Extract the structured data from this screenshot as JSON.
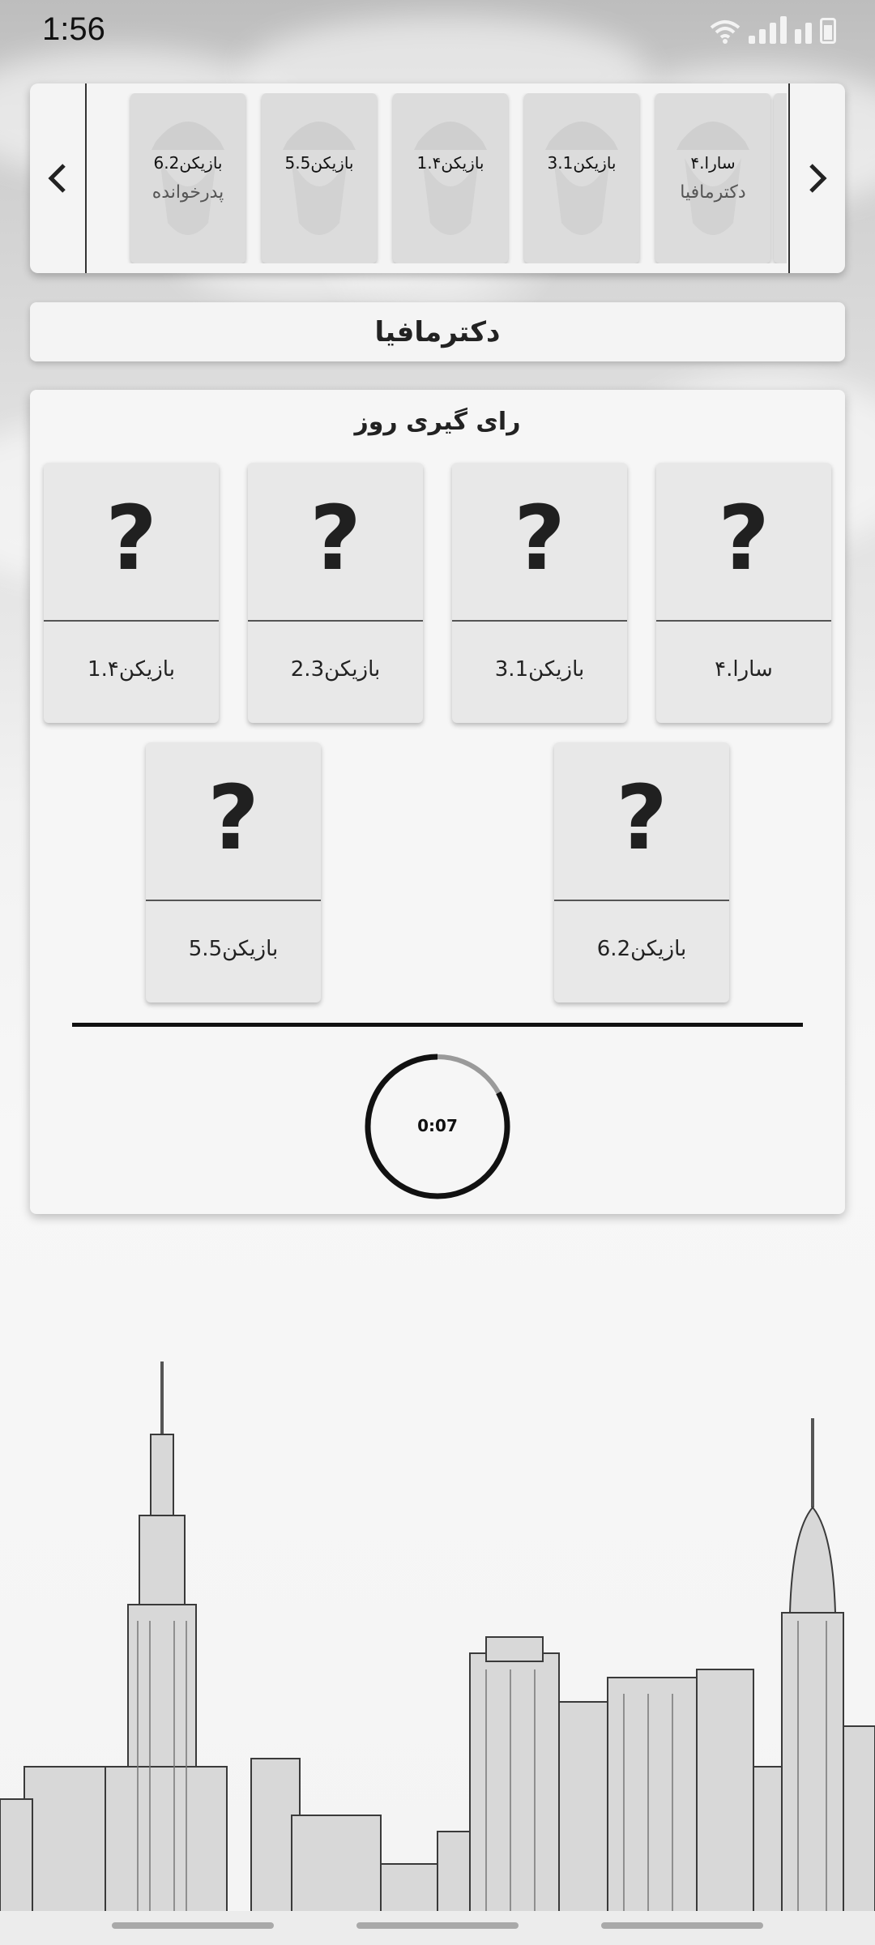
{
  "status_bar": {
    "time": "1:56"
  },
  "carousel": {
    "prev_icon": "chevron-left-icon",
    "next_icon": "chevron-right-icon",
    "players": [
      {
        "name": "۴.سارا",
        "role": "دکترمافیا"
      },
      {
        "name": "3.بازیکن1",
        "role": ""
      },
      {
        "name": "1.بازیکن۴",
        "role": ""
      },
      {
        "name": "5.بازیکن5",
        "role": ""
      },
      {
        "name": "6.بازیکن2",
        "role": "پدرخوانده"
      }
    ]
  },
  "title": "دکترمافیا",
  "voting": {
    "title": "رای گیری روز",
    "question_mark": "?",
    "cards": [
      {
        "name": "۴.سارا"
      },
      {
        "name": "3.بازیکن1"
      },
      {
        "name": "2.بازیکن3"
      },
      {
        "name": "1.بازیکن۴"
      },
      {
        "name": "6.بازیکن2"
      },
      {
        "name": "5.بازیکن5"
      }
    ],
    "timer": {
      "text": "0:07",
      "remaining_fraction": 0.83
    }
  }
}
